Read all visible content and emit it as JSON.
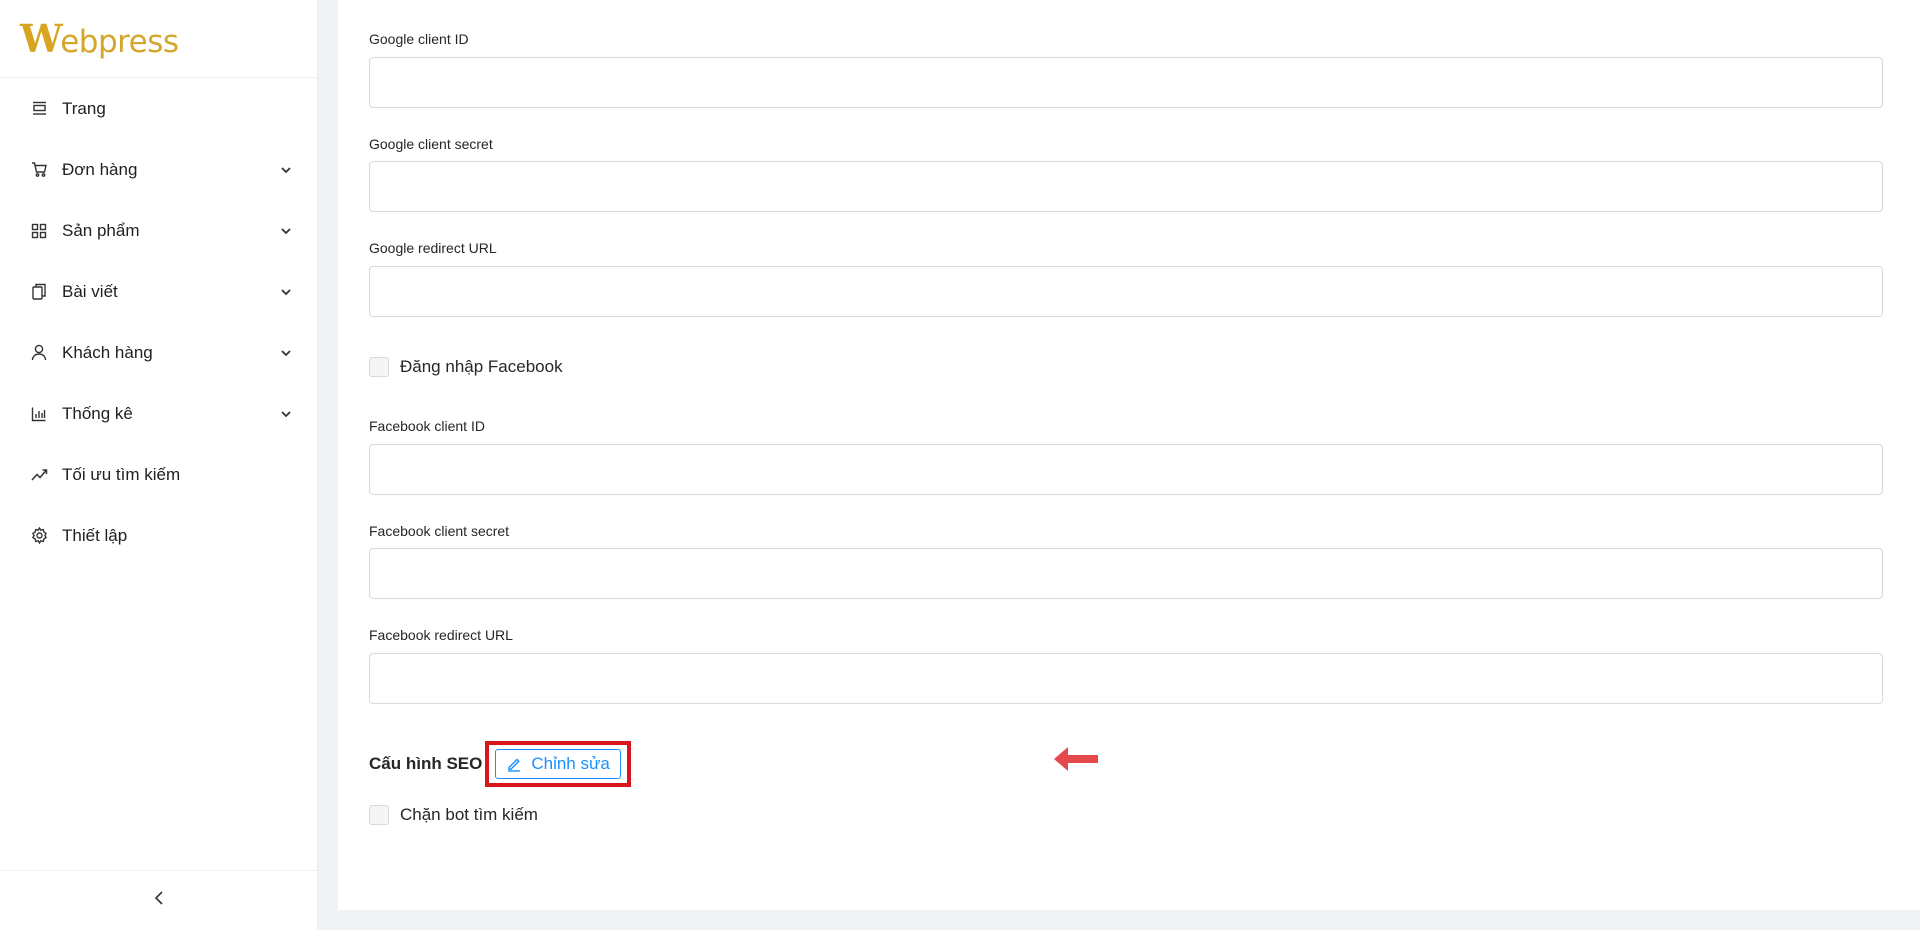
{
  "brand": {
    "logo_text": "Webpress",
    "logo_first": "W",
    "logo_rest": "ebpress",
    "accent": "#d4a72c"
  },
  "sidebar": {
    "items": [
      {
        "label": "Trang",
        "icon": "page-icon",
        "has_submenu": false
      },
      {
        "label": "Đơn hàng",
        "icon": "cart-icon",
        "has_submenu": true
      },
      {
        "label": "Sản phẩm",
        "icon": "grid-icon",
        "has_submenu": true
      },
      {
        "label": "Bài viết",
        "icon": "copy-icon",
        "has_submenu": true
      },
      {
        "label": "Khách hàng",
        "icon": "user-icon",
        "has_submenu": true
      },
      {
        "label": "Thống kê",
        "icon": "bar-chart-icon",
        "has_submenu": true
      },
      {
        "label": "Tối ưu tìm kiếm",
        "icon": "trend-icon",
        "has_submenu": false
      },
      {
        "label": "Thiết lập",
        "icon": "gear-icon",
        "has_submenu": false
      }
    ],
    "collapse_icon": "chevron-left-icon"
  },
  "form": {
    "google_client_id": {
      "label": "Google client ID",
      "value": ""
    },
    "google_client_secret": {
      "label": "Google client secret",
      "value": ""
    },
    "google_redirect_url": {
      "label": "Google redirect URL",
      "value": ""
    },
    "facebook_login": {
      "label": "Đăng nhập Facebook",
      "checked": false
    },
    "facebook_client_id": {
      "label": "Facebook client ID",
      "value": ""
    },
    "facebook_client_secret": {
      "label": "Facebook client secret",
      "value": ""
    },
    "facebook_redirect_url": {
      "label": "Facebook redirect URL",
      "value": ""
    },
    "seo": {
      "title": "Cấu hình SEO",
      "edit_label": "Chỉnh sửa",
      "edit_icon": "edit-icon"
    },
    "block_bots": {
      "label": "Chặn bot tìm kiếm",
      "checked": false
    }
  },
  "annotation": {
    "highlight_color": "#d9161c",
    "arrow_color": "#e5484d"
  },
  "colors": {
    "primary": "#1890ff",
    "background": "#f0f2f5"
  }
}
